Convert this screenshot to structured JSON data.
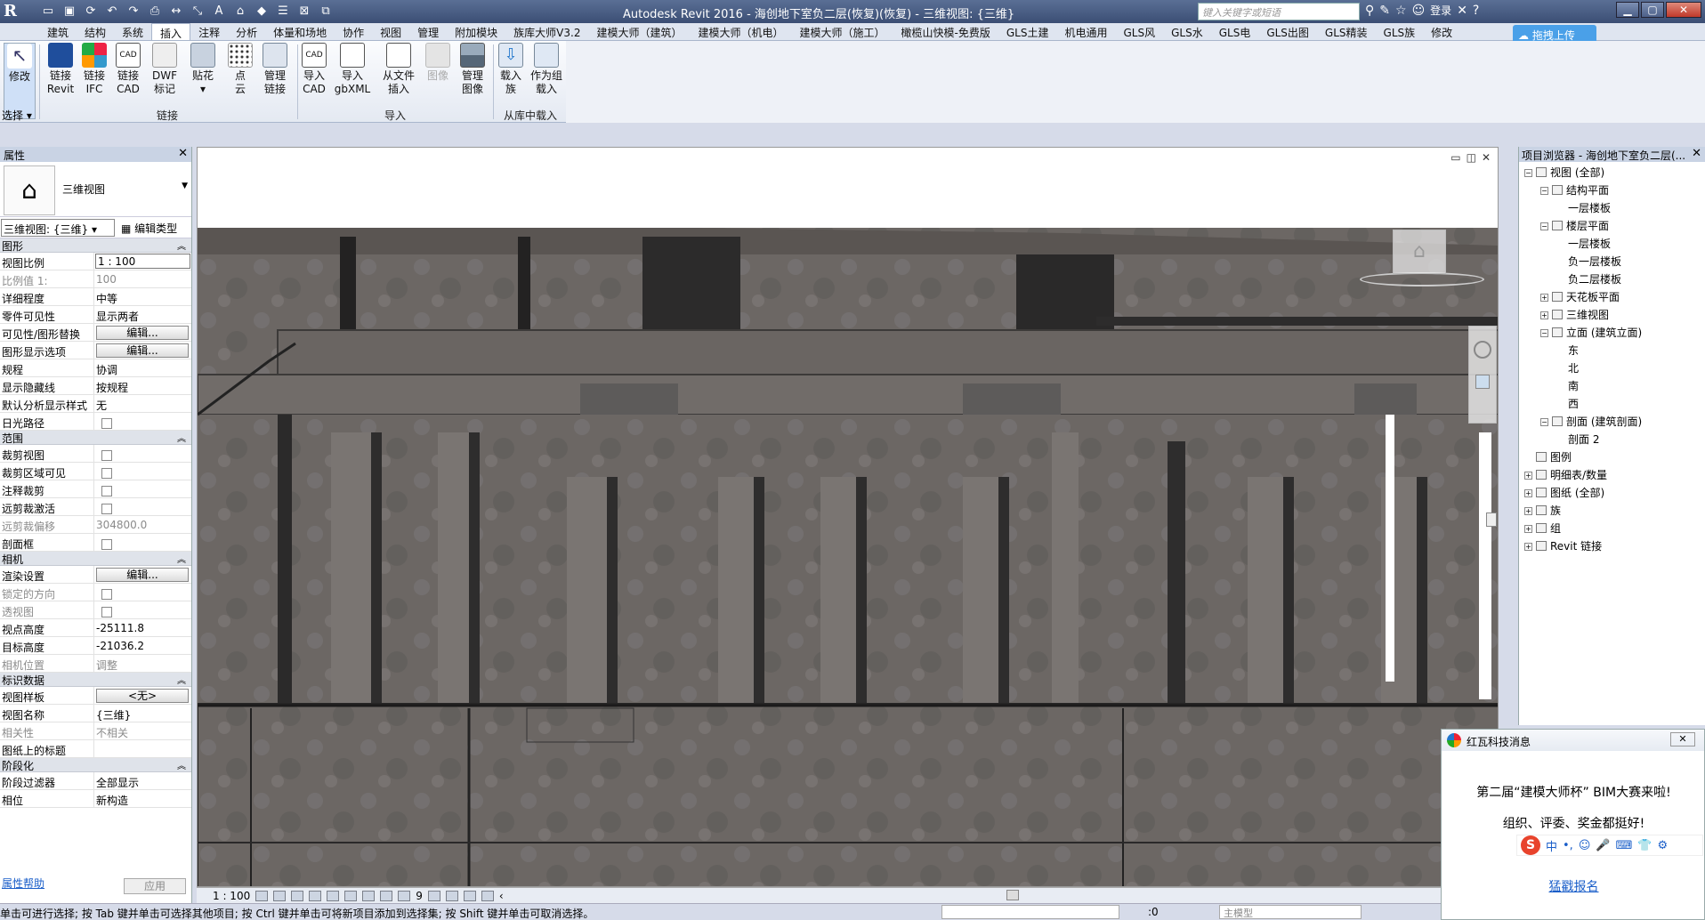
{
  "titlebar": {
    "logo": "R",
    "title": "Autodesk Revit 2016 -     海创地下室负二层(恢复)(恢复) - 三维视图: {三维}",
    "search_placeholder": "键入关键字或短语",
    "login": "登录",
    "help": "?"
  },
  "ribbon": {
    "tabs": [
      "建筑",
      "结构",
      "系统",
      "插入",
      "注释",
      "分析",
      "体量和场地",
      "协作",
      "视图",
      "管理",
      "附加模块",
      "族库大师V3.2",
      "建模大师（建筑）",
      "建模大师（机电）",
      "建模大师（施工）",
      "橄榄山快模-免费版",
      "GLS土建",
      "机电通用",
      "GLS风",
      "GLS水",
      "GLS电",
      "GLS出图",
      "GLS精装",
      "GLS族",
      "修改"
    ],
    "active_tab": "插入",
    "upload_button": "拖拽上传",
    "buttons": {
      "modify": "修改",
      "select": "选择",
      "link_revit": [
        "链接",
        "Revit"
      ],
      "link_ifc": [
        "链接",
        "IFC"
      ],
      "link_cad": [
        "链接",
        "CAD"
      ],
      "dwf": [
        "DWF",
        "标记"
      ],
      "decal": [
        "贴花",
        "▾"
      ],
      "point_cloud": [
        "点",
        "云"
      ],
      "manage_links": [
        "管理",
        "链接"
      ],
      "import_cad": [
        "导入",
        "CAD"
      ],
      "import_gbxml": [
        "导入",
        "gbXML"
      ],
      "insert_from_file": [
        "从文件",
        "插入"
      ],
      "image": "图像",
      "manage_images": [
        "管理",
        "图像"
      ],
      "load_family": [
        "载入",
        "族"
      ],
      "load_as_group": [
        "作为组",
        "载入"
      ]
    },
    "groups": {
      "link": "链接",
      "import": "导入",
      "load_from_library": "从库中载入"
    }
  },
  "properties": {
    "title": "属性",
    "type_name": "三维视图",
    "view_selector": "三维视图: {三维}",
    "edit_type": "编辑类型",
    "sections": {
      "graphics": "图形",
      "extents": "范围",
      "camera": "相机",
      "identity": "标识数据",
      "phasing": "阶段化"
    },
    "rows": {
      "scale_label": "视图比例",
      "scale_value": "1 : 100",
      "scale_factor_label": "比例值 1:",
      "scale_factor_value": "100",
      "detail_label": "详细程度",
      "detail_value": "中等",
      "parts_label": "零件可见性",
      "parts_value": "显示两者",
      "vg_label": "可见性/图形替换",
      "vg_value": "编辑...",
      "display_label": "图形显示选项",
      "display_value": "编辑...",
      "discipline_label": "规程",
      "discipline_value": "协调",
      "hidden_label": "显示隐藏线",
      "hidden_value": "按规程",
      "analysis_label": "默认分析显示样式",
      "analysis_value": "无",
      "sunpath_label": "日光路径",
      "crop_label": "裁剪视图",
      "crop_visible_label": "裁剪区域可见",
      "annotation_crop_label": "注释裁剪",
      "far_clip_label": "远剪裁激活",
      "far_offset_label": "远剪裁偏移",
      "far_offset_value": "304800.0",
      "section_box_label": "剖面框",
      "render_label": "渲染设置",
      "render_value": "编辑...",
      "locked_label": "锁定的方向",
      "perspective_label": "透视图",
      "eye_label": "视点高度",
      "eye_value": "-25111.8",
      "target_label": "目标高度",
      "target_value": "-21036.2",
      "camera_pos_label": "相机位置",
      "camera_pos_value": "调整",
      "template_label": "视图样板",
      "template_value": "<无>",
      "viewname_label": "视图名称",
      "viewname_value": "{三维}",
      "dependency_label": "相关性",
      "dependency_value": "不相关",
      "sheet_title_label": "图纸上的标题",
      "sheet_title_value": "",
      "phase_filter_label": "阶段过滤器",
      "phase_filter_value": "全部显示",
      "phase_label": "相位",
      "phase_value": "新构造"
    },
    "help_link": "属性帮助",
    "apply": "应用"
  },
  "viewport": {
    "scale": "1 : 100",
    "view_controls": [
      "▭",
      "◫",
      "✕"
    ],
    "hidden_count": "9"
  },
  "browser": {
    "title": "项目浏览器 - 海创地下室负二层(...",
    "tree": [
      {
        "label": "视图 (全部)",
        "level": 0,
        "tog": "−"
      },
      {
        "label": "结构平面",
        "level": 1,
        "tog": "−"
      },
      {
        "label": "一层楼板",
        "level": 2,
        "tog": ""
      },
      {
        "label": "楼层平面",
        "level": 1,
        "tog": "−"
      },
      {
        "label": "一层楼板",
        "level": 2,
        "tog": ""
      },
      {
        "label": "负一层楼板",
        "level": 2,
        "tog": ""
      },
      {
        "label": "负二层楼板",
        "level": 2,
        "tog": ""
      },
      {
        "label": "天花板平面",
        "level": 1,
        "tog": "+"
      },
      {
        "label": "三维视图",
        "level": 1,
        "tog": "+"
      },
      {
        "label": "立面 (建筑立面)",
        "level": 1,
        "tog": "−"
      },
      {
        "label": "东",
        "level": 2,
        "tog": ""
      },
      {
        "label": "北",
        "level": 2,
        "tog": ""
      },
      {
        "label": "南",
        "level": 2,
        "tog": ""
      },
      {
        "label": "西",
        "level": 2,
        "tog": ""
      },
      {
        "label": "剖面 (建筑剖面)",
        "level": 1,
        "tog": "−"
      },
      {
        "label": "剖面 2",
        "level": 2,
        "tog": ""
      },
      {
        "label": "图例",
        "level": 0,
        "tog": ""
      },
      {
        "label": "明细表/数量",
        "level": 0,
        "tog": "+"
      },
      {
        "label": "图纸 (全部)",
        "level": 0,
        "tog": "+"
      },
      {
        "label": "族",
        "level": 0,
        "tog": "+"
      },
      {
        "label": "组",
        "level": 0,
        "tog": "+"
      },
      {
        "label": "Revit 链接",
        "level": 0,
        "tog": "+"
      }
    ]
  },
  "popup": {
    "title": "红瓦科技消息",
    "close": "✕",
    "line1": "第二届“建模大师杯” BIM大赛来啦!",
    "line2": "组织、评委、奖金都挺好!",
    "link": "猛戳报名",
    "ime": [
      "S",
      "中",
      "•,",
      "☺",
      "🎤",
      "⌨",
      "👕",
      "⚙"
    ]
  },
  "statusbar": {
    "text": "单击可进行选择; 按 Tab 键并单击可选择其他项目; 按 Ctrl 键并单击可将新项目添加到选择集; 按 Shift 键并单击可取消选择。",
    "selection_count": ":0",
    "model": "主模型"
  },
  "colors": {
    "title_bar": "#3b4e74",
    "concrete": "#6f6a66",
    "accent": "#4aa0e8"
  }
}
